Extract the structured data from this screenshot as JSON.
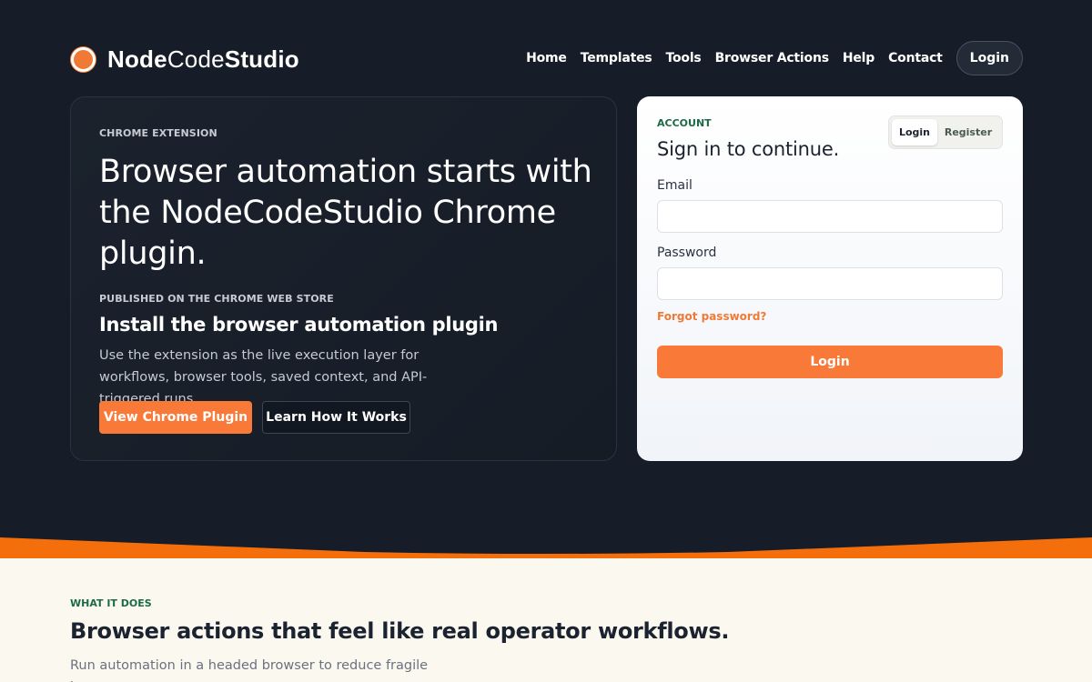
{
  "brand": {
    "name_part1": "Node",
    "name_part2": "Code",
    "name_part3": "Studio",
    "accent_color": "#f97a38",
    "green_color": "#1b6b45"
  },
  "nav": {
    "items": [
      "Home",
      "Templates",
      "Tools",
      "Browser Actions",
      "Help",
      "Contact"
    ],
    "login_label": "Login"
  },
  "hero": {
    "eyebrow": "CHROME EXTENSION",
    "title": "Browser automation starts with the NodeCodeStudio Chrome plugin.",
    "store_eyebrow": "PUBLISHED ON THE CHROME WEB STORE",
    "subtitle": "Install the browser automation plugin",
    "description": "Use the extension as the live execution layer for workflows, browser tools, saved context, and API-triggered runs.",
    "primary_button": "View Chrome Plugin",
    "secondary_button": "Learn How It Works"
  },
  "account": {
    "eyebrow": "ACCOUNT",
    "title": "Sign in to continue.",
    "tabs": [
      "Login",
      "Register"
    ],
    "email_label": "Email",
    "email_value": "",
    "password_label": "Password",
    "password_value": "",
    "forgot_label": "Forgot password?",
    "submit_label": "Login"
  },
  "what_it_does": {
    "eyebrow": "WHAT IT DOES",
    "title": "Browser actions that feel like real operator workflows.",
    "description": "Run automation in a headed browser to reduce fragile bot"
  }
}
